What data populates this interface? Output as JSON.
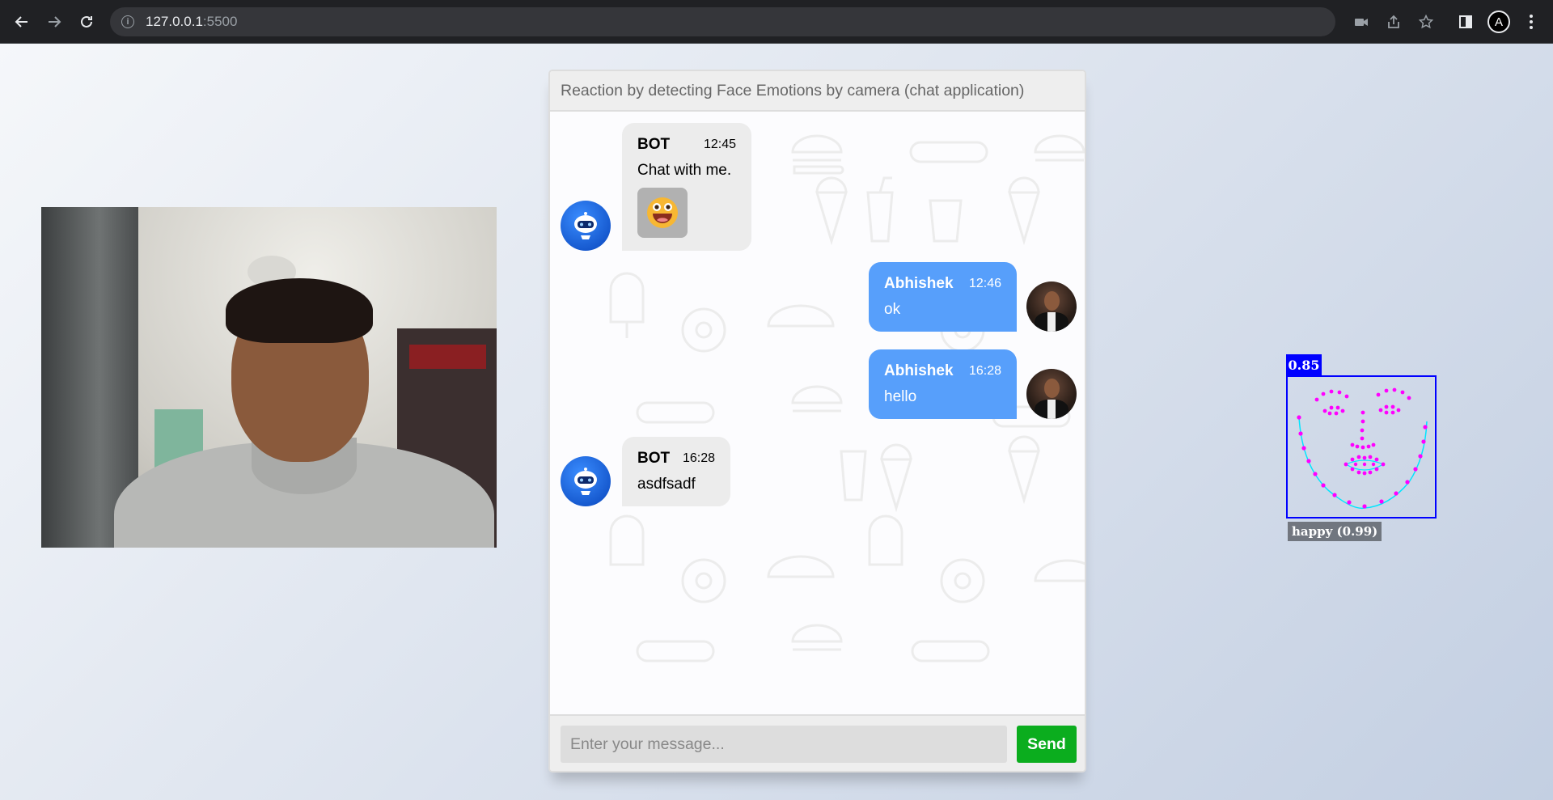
{
  "browser": {
    "url_host": "127.0.0.1",
    "url_port": ":5500",
    "profile_initial": "A"
  },
  "chat": {
    "header_title": "Reaction by detecting Face Emotions by camera (chat application)",
    "messages": [
      {
        "side": "left",
        "sender": "BOT",
        "time": "12:45",
        "text": "Chat with me."
      },
      {
        "side": "right",
        "sender": "Abhishek",
        "time": "12:46",
        "text": "ok"
      },
      {
        "side": "right",
        "sender": "Abhishek",
        "time": "16:28",
        "text": "hello"
      },
      {
        "side": "left",
        "sender": "BOT",
        "time": "16:28",
        "text": "asdfsadf"
      }
    ],
    "input_placeholder": "Enter your message...",
    "send_label": "Send"
  },
  "detection": {
    "score": "0.85",
    "label": "happy (0.99)",
    "box_color": "#0000ff",
    "landmark_color": "#ff00ff",
    "jaw_color": "#00e5ff"
  },
  "colors": {
    "user_bubble": "#579ffb",
    "bot_bubble": "#ececec",
    "send_button": "#0bad1e"
  }
}
